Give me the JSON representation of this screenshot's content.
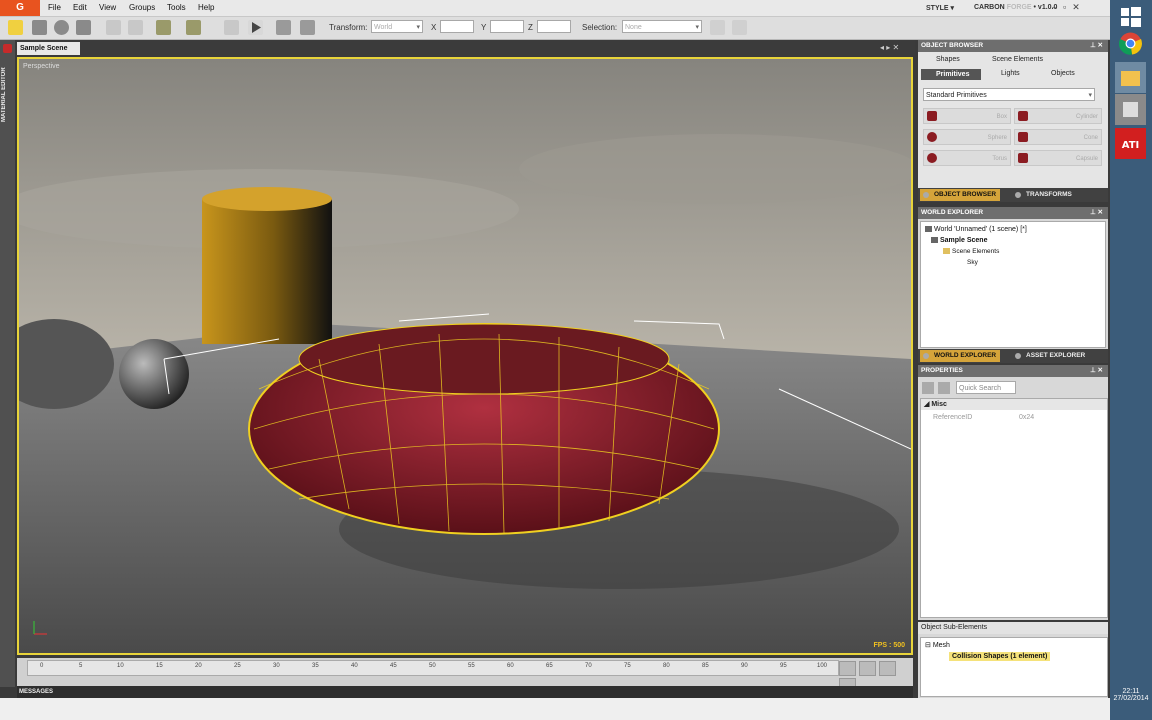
{
  "menubar": {
    "logo": "G",
    "items": [
      "File",
      "Edit",
      "View",
      "Groups",
      "Tools",
      "Help"
    ],
    "style_menu": "STYLE ▾",
    "brand_main": "CARBON",
    "brand_sub": "FORGE",
    "version": "• v1.0.0"
  },
  "toolbar": {
    "transform_label": "Transform:",
    "transform_value": "World",
    "x_label": "X",
    "y_label": "Y",
    "z_label": "Z",
    "selection_label": "Selection:",
    "selection_value": "None"
  },
  "viewport": {
    "tab": "Sample Scene",
    "view_label": "Perspective",
    "fps": "FPS : 500",
    "side_label": "MATERIAL EDITOR"
  },
  "timeline": {
    "ticks": [
      "0",
      "5",
      "10",
      "15",
      "20",
      "25",
      "30",
      "35",
      "40",
      "45",
      "50",
      "55",
      "60",
      "65",
      "70",
      "75",
      "80",
      "85",
      "90",
      "95",
      "100"
    ]
  },
  "messages": {
    "label": "MESSAGES"
  },
  "object_browser": {
    "title": "OBJECT BROWSER",
    "tabs": [
      "Shapes",
      "Scene Elements",
      "Primitives",
      "Lights",
      "Objects"
    ],
    "dropdown": "Standard Primitives",
    "primitives": [
      "Box",
      "Cylinder",
      "Sphere",
      "Cone",
      "Torus",
      "Capsule"
    ],
    "footer_tabs": [
      "OBJECT BROWSER",
      "TRANSFORMS"
    ]
  },
  "world_explorer": {
    "title": "WORLD EXPLORER",
    "tree": [
      "World 'Unnamed' (1 scene) [*]",
      "Sample Scene",
      "Scene Elements",
      "Sky"
    ],
    "footer_tabs": [
      "WORLD EXPLORER",
      "ASSET EXPLORER"
    ]
  },
  "properties": {
    "title": "PROPERTIES",
    "search_placeholder": "Quick Search",
    "section": "Misc",
    "row_label": "ReferenceID",
    "row_value": "0x24"
  },
  "sub_elements": {
    "title": "Object Sub-Elements",
    "mesh": "Mesh",
    "collision": "Collision Shapes (1 element)"
  },
  "taskbar": {
    "time": "22:11",
    "date": "27/02/2014"
  },
  "colors": {
    "accent_orange": "#e8531f",
    "selection_yellow": "#e8d43a",
    "torus_red": "#8b1c22"
  }
}
